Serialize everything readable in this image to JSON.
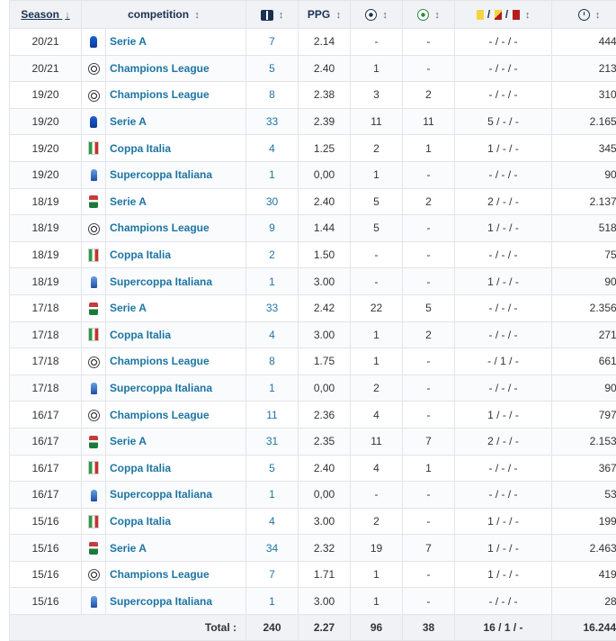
{
  "headers": {
    "season": "Season",
    "competition": "competition",
    "ppg": "PPG",
    "sort_arrow": "↕",
    "sort_down": "↓",
    "card_sep": "/"
  },
  "colors": {
    "link": "#1d75a3",
    "header_bg": "#f0f2f5",
    "header_text": "#1a3151",
    "yellow_card": "#f3d544",
    "red_card": "#b51d1d"
  },
  "rows": [
    {
      "season": "20/21",
      "icon": "serie-a-icon",
      "competition": "Serie A",
      "apps": "7",
      "ppg": "2.14",
      "goals": "-",
      "assists": "-",
      "cards": "- / - / -",
      "minutes": "444'"
    },
    {
      "season": "20/21",
      "icon": "champions-league-icon",
      "competition": "Champions League",
      "apps": "5",
      "ppg": "2.40",
      "goals": "1",
      "assists": "-",
      "cards": "- / - / -",
      "minutes": "213'"
    },
    {
      "season": "19/20",
      "icon": "champions-league-icon",
      "competition": "Champions League",
      "apps": "8",
      "ppg": "2.38",
      "goals": "3",
      "assists": "2",
      "cards": "- / - / -",
      "minutes": "310'"
    },
    {
      "season": "19/20",
      "icon": "serie-a-icon",
      "competition": "Serie A",
      "apps": "33",
      "ppg": "2.39",
      "goals": "11",
      "assists": "11",
      "cards": "5 / - / -",
      "minutes": "2.165'"
    },
    {
      "season": "19/20",
      "icon": "coppa-italia-icon",
      "competition": "Coppa Italia",
      "apps": "4",
      "ppg": "1.25",
      "goals": "2",
      "assists": "1",
      "cards": "1 / - / -",
      "minutes": "345'"
    },
    {
      "season": "19/20",
      "icon": "supercoppa-icon",
      "competition": "Supercoppa Italiana",
      "apps": "1",
      "ppg": "0,00",
      "goals": "1",
      "assists": "-",
      "cards": "- / - / -",
      "minutes": "90'"
    },
    {
      "season": "18/19",
      "icon": "serie-a-old-icon",
      "competition": "Serie A",
      "apps": "30",
      "ppg": "2.40",
      "goals": "5",
      "assists": "2",
      "cards": "2 / - / -",
      "minutes": "2.137'"
    },
    {
      "season": "18/19",
      "icon": "champions-league-icon",
      "competition": "Champions League",
      "apps": "9",
      "ppg": "1.44",
      "goals": "5",
      "assists": "-",
      "cards": "1 / - / -",
      "minutes": "518'"
    },
    {
      "season": "18/19",
      "icon": "coppa-italia-icon",
      "competition": "Coppa Italia",
      "apps": "2",
      "ppg": "1.50",
      "goals": "-",
      "assists": "-",
      "cards": "- / - / -",
      "minutes": "75'"
    },
    {
      "season": "18/19",
      "icon": "supercoppa-icon",
      "competition": "Supercoppa Italiana",
      "apps": "1",
      "ppg": "3.00",
      "goals": "-",
      "assists": "-",
      "cards": "1 / - / -",
      "minutes": "90'"
    },
    {
      "season": "17/18",
      "icon": "serie-a-old-icon",
      "competition": "Serie A",
      "apps": "33",
      "ppg": "2.42",
      "goals": "22",
      "assists": "5",
      "cards": "- / - / -",
      "minutes": "2.356'"
    },
    {
      "season": "17/18",
      "icon": "coppa-italia-icon",
      "competition": "Coppa Italia",
      "apps": "4",
      "ppg": "3.00",
      "goals": "1",
      "assists": "2",
      "cards": "- / - / -",
      "minutes": "271'"
    },
    {
      "season": "17/18",
      "icon": "champions-league-icon",
      "competition": "Champions League",
      "apps": "8",
      "ppg": "1.75",
      "goals": "1",
      "assists": "-",
      "cards": "- / 1 / -",
      "minutes": "661'"
    },
    {
      "season": "17/18",
      "icon": "supercoppa-icon",
      "competition": "Supercoppa Italiana",
      "apps": "1",
      "ppg": "0,00",
      "goals": "2",
      "assists": "-",
      "cards": "- / - / -",
      "minutes": "90'"
    },
    {
      "season": "16/17",
      "icon": "champions-league-icon",
      "competition": "Champions League",
      "apps": "11",
      "ppg": "2.36",
      "goals": "4",
      "assists": "-",
      "cards": "1 / - / -",
      "minutes": "797'"
    },
    {
      "season": "16/17",
      "icon": "serie-a-old-icon",
      "competition": "Serie A",
      "apps": "31",
      "ppg": "2.35",
      "goals": "11",
      "assists": "7",
      "cards": "2 / - / -",
      "minutes": "2.153'"
    },
    {
      "season": "16/17",
      "icon": "coppa-italia-icon",
      "competition": "Coppa Italia",
      "apps": "5",
      "ppg": "2.40",
      "goals": "4",
      "assists": "1",
      "cards": "- / - / -",
      "minutes": "367'"
    },
    {
      "season": "16/17",
      "icon": "supercoppa-icon",
      "competition": "Supercoppa Italiana",
      "apps": "1",
      "ppg": "0,00",
      "goals": "-",
      "assists": "-",
      "cards": "- / - / -",
      "minutes": "53'"
    },
    {
      "season": "15/16",
      "icon": "coppa-italia-icon",
      "competition": "Coppa Italia",
      "apps": "4",
      "ppg": "3.00",
      "goals": "2",
      "assists": "-",
      "cards": "1 / - / -",
      "minutes": "199'"
    },
    {
      "season": "15/16",
      "icon": "serie-a-old-icon",
      "competition": "Serie A",
      "apps": "34",
      "ppg": "2.32",
      "goals": "19",
      "assists": "7",
      "cards": "1 / - / -",
      "minutes": "2.463'"
    },
    {
      "season": "15/16",
      "icon": "champions-league-icon",
      "competition": "Champions League",
      "apps": "7",
      "ppg": "1.71",
      "goals": "1",
      "assists": "-",
      "cards": "1 / - / -",
      "minutes": "419'"
    },
    {
      "season": "15/16",
      "icon": "supercoppa-icon",
      "competition": "Supercoppa Italiana",
      "apps": "1",
      "ppg": "3.00",
      "goals": "1",
      "assists": "-",
      "cards": "- / - / -",
      "minutes": "28'"
    }
  ],
  "totals": {
    "label": "Total :",
    "apps": "240",
    "ppg": "2.27",
    "goals": "96",
    "assists": "38",
    "cards": "16 / 1 / -",
    "minutes": "16.244'"
  }
}
